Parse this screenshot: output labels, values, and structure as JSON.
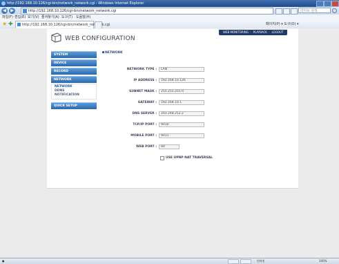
{
  "browser": {
    "title": "http://192.168.10.126/cgi-bin/network_network.cgi - Windows Internet Explorer",
    "url": "http://192.168.10.126/cgi-bin/network_network.cgi",
    "search_placeholder": "라이브 검색",
    "menu": [
      "파일(F)",
      "편집(E)",
      "보기(V)",
      "즐겨찾기(A)",
      "도구(T)",
      "도움말(H)"
    ],
    "tab_title": "http://192.168.10.126/cgi-bin/network_network.cgi",
    "tools": "페이지(P) ▾  도구(O) ▾",
    "status": "인터넷",
    "zoom": "100%"
  },
  "app": {
    "title": "WEB CONFIGURATION",
    "top_nav": [
      "WEB MONITORING",
      "PLAYBACK",
      "LOGOUT"
    ]
  },
  "sidebar": {
    "items": [
      "SYSTEM",
      "DEVICE",
      "RECORD",
      "NETWORK"
    ],
    "sub_items": [
      "NETWORK",
      "DDNS",
      "NOTIFICATION"
    ],
    "active_sub": "NETWORK",
    "quick_setup": "QUICK SETUP"
  },
  "main": {
    "section_title": "NETWORK",
    "fields": [
      {
        "label": "NETWORK TYPE :",
        "value": "LAN"
      },
      {
        "label": "IP ADDRESS :",
        "value": "192.168.10.126"
      },
      {
        "label": "SUBNET MASK :",
        "value": "255.255.255.0"
      },
      {
        "label": "GATEWAY :",
        "value": "192.168.10.1"
      },
      {
        "label": "DNS SERVER :",
        "value": "203.248.252.2"
      },
      {
        "label": "TCP/IP PORT :",
        "value": "9010"
      },
      {
        "label": "MOBILE PORT :",
        "value": "9011"
      },
      {
        "label": "WEB PORT :",
        "value": "80"
      }
    ],
    "upnp_label": "USE UPNP NAT TRAVERSAL",
    "upnp_checked": false
  }
}
